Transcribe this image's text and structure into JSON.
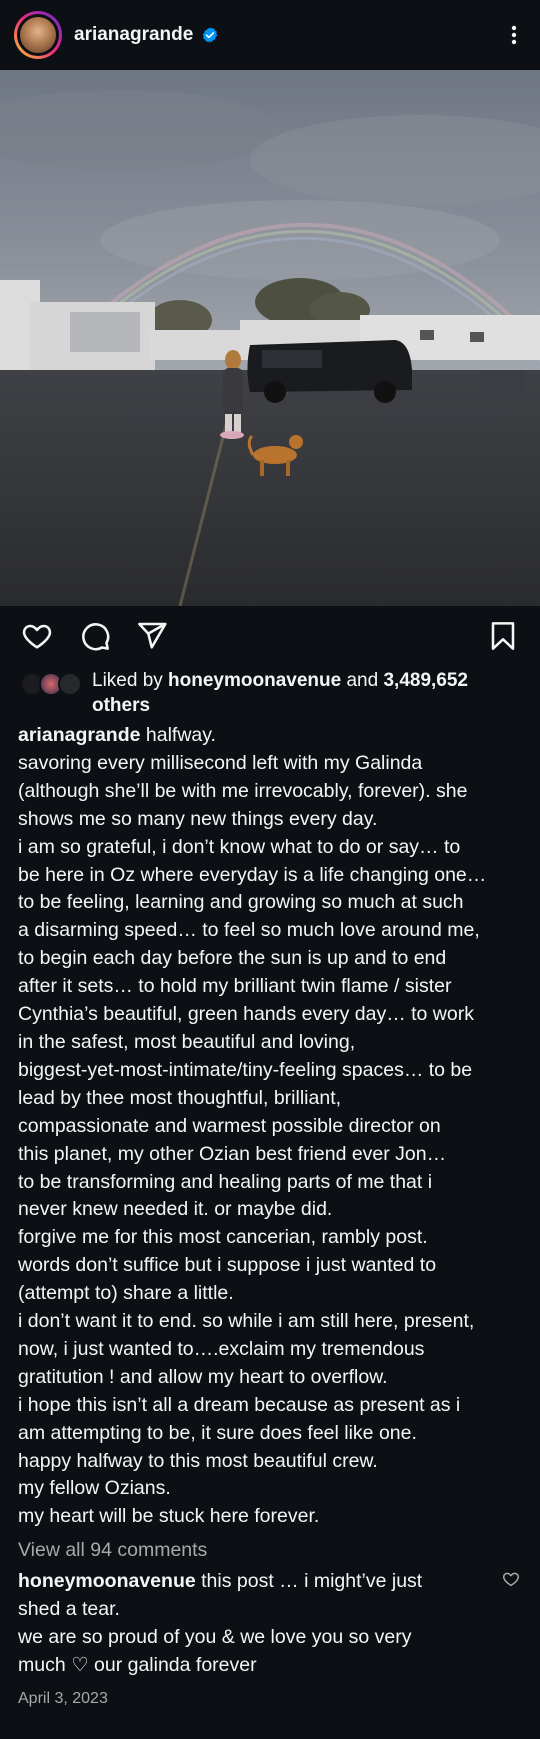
{
  "header": {
    "username": "arianagrande",
    "verified": true,
    "menu_icon": "more-vertical-icon"
  },
  "post": {
    "image_icon": "photo-rainbow-scene",
    "actions": {
      "like_icon": "heart-icon",
      "comment_icon": "comment-icon",
      "share_icon": "send-icon",
      "save_icon": "bookmark-icon"
    },
    "likes": {
      "prefix": "Liked by ",
      "liked_by": "honeymoonavenue",
      "middle": " and ",
      "count": "3,489,652",
      "suffix_line2": "others"
    },
    "caption": {
      "author": "arianagrande",
      "first_line": " halfway.",
      "lines": [
        "savoring every millisecond left with my Galinda",
        "(although she’ll be with me irrevocably, forever). she",
        "shows me so many new things every day.",
        "i am so grateful, i don’t know what to do or say… to",
        "be here in Oz where everyday is a life changing one…",
        "to be feeling, learning and growing so much at such",
        "a disarming speed… to feel so much love around me,",
        "to begin each day before the sun is up and to end",
        "after it sets… to hold my brilliant twin flame / sister",
        "Cynthia’s beautiful, green hands every day… to work",
        "in the safest, most beautiful and loving,",
        "biggest-yet-most-intimate/tiny-feeling spaces… to be",
        "lead by thee most thoughtful, brilliant,",
        "compassionate and warmest possible director on",
        "this planet, my other Ozian best friend ever Jon…",
        "to be transforming and healing parts of me that i",
        "never knew needed it. or maybe did.",
        "forgive me for this most cancerian, rambly post.",
        "words don’t suffice but i suppose i just wanted to",
        "(attempt to) share a little.",
        "i don’t want it to end. so while i am still here, present,",
        "now, i just wanted to….exclaim my tremendous",
        "gratitution ! and allow my heart to overflow.",
        "i hope this isn’t all a dream because as present as i",
        "am attempting to be, it sure does feel like one.",
        "happy halfway to this most beautiful crew.",
        "my fellow Ozians.",
        "my heart will be stuck here forever."
      ]
    },
    "view_comments": "View all 94 comments",
    "top_comment": {
      "author": "honeymoonavenue",
      "first_line": " this post … i might’ve just",
      "lines": [
        "shed a tear.",
        "we are so proud of you & we love you so very",
        "much ♡ our galinda forever"
      ],
      "like_icon": "heart-outline-small-icon"
    },
    "date": "April 3, 2023"
  },
  "colors": {
    "background": "#0c1014",
    "text": "#f5f5f5",
    "muted": "#a8a8a8",
    "verified_blue": "#0095f6"
  }
}
